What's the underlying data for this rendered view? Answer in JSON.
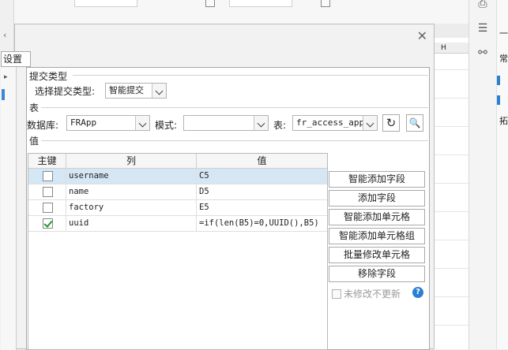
{
  "background": {
    "sheet_col_header": "H",
    "right_panel_text": [
      "一",
      "常",
      "拓"
    ]
  },
  "dialog": {
    "tab_label": "设置",
    "submit_type": {
      "section_title": "提交类型",
      "label": "选择提交类型:",
      "value": "智能提交"
    },
    "table_section": {
      "section_title": "表",
      "db_label": "数据库:",
      "db_value": "FRApp",
      "schema_label": "模式:",
      "schema_value": "",
      "table_label": "表:",
      "table_value": "fr_access_app"
    },
    "value_section": {
      "section_title": "值",
      "columns": [
        "主键",
        "列",
        "值"
      ],
      "rows": [
        {
          "key": false,
          "column": "username",
          "value": "C5",
          "selected": true
        },
        {
          "key": false,
          "column": "name",
          "value": "D5",
          "selected": false
        },
        {
          "key": false,
          "column": "factory",
          "value": "E5",
          "selected": false
        },
        {
          "key": true,
          "column": "uuid",
          "value": "=if(len(B5)=0,UUID(),B5)",
          "selected": false
        }
      ]
    },
    "buttons": {
      "smart_add_field": "智能添加字段",
      "add_field": "添加字段",
      "smart_add_cell": "智能添加单元格",
      "smart_add_cell_group": "智能添加单元格组",
      "batch_edit_cell": "批量修改单元格",
      "remove_field": "移除字段"
    },
    "no_update_if_unchanged": "未修改不更新",
    "help_symbol": "?"
  }
}
